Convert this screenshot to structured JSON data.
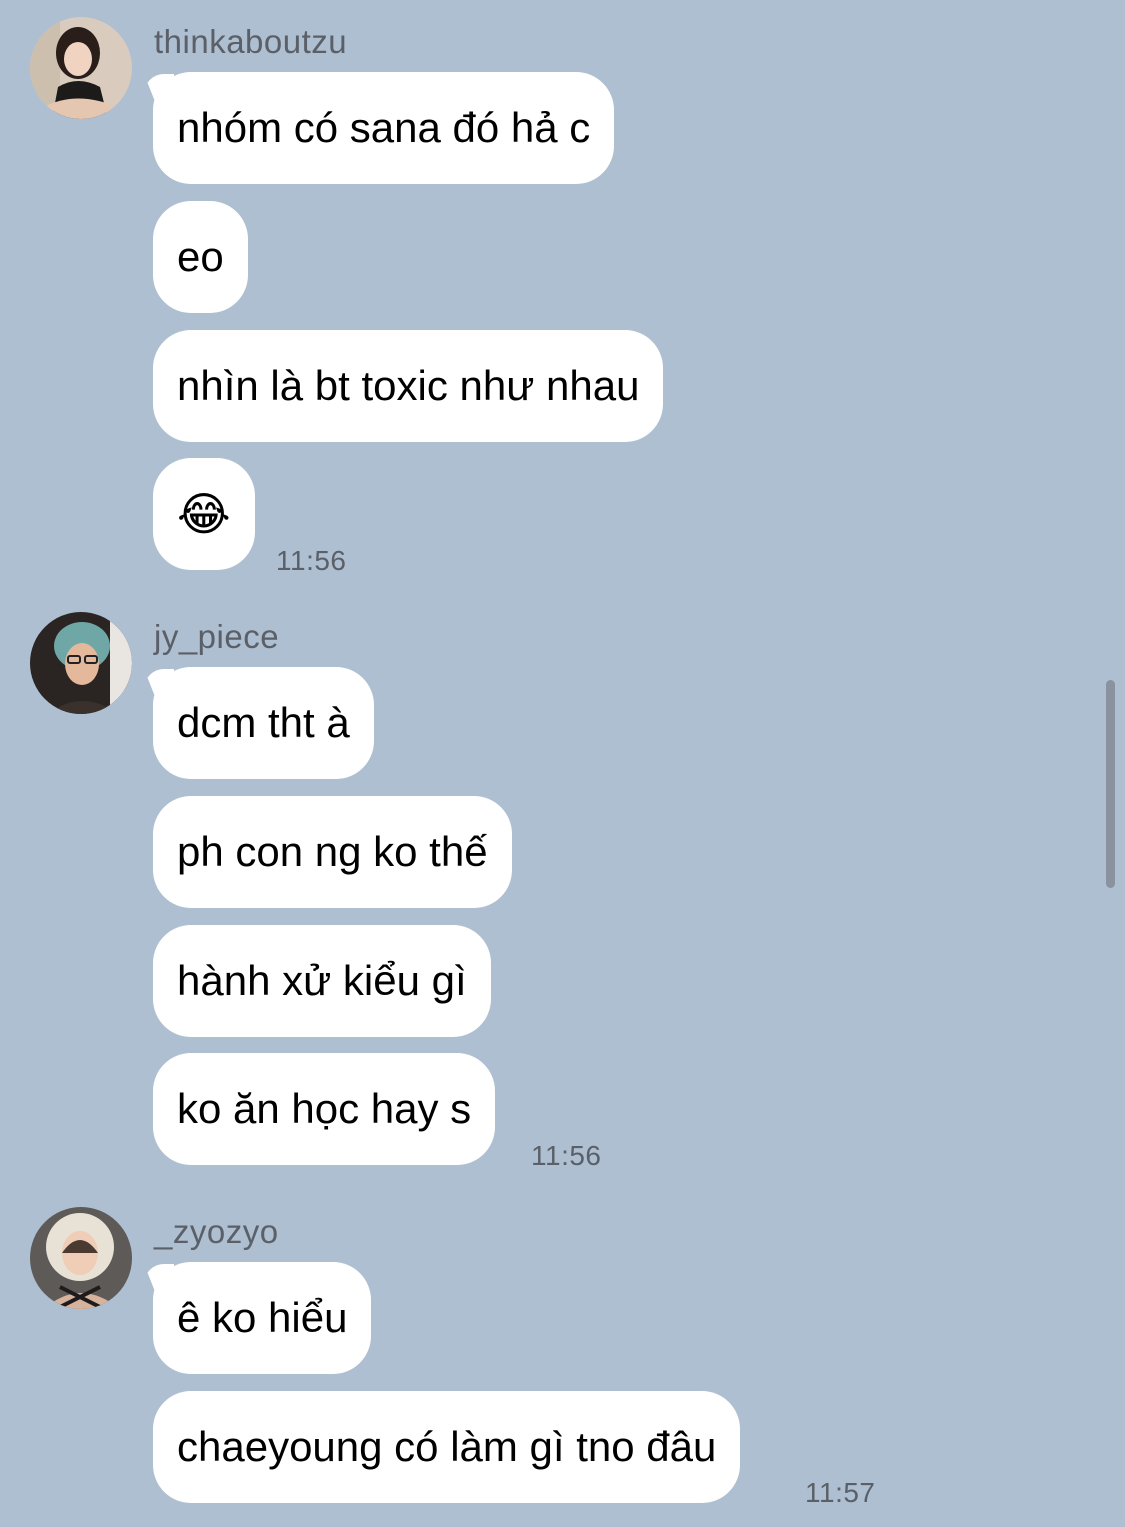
{
  "messages": [
    {
      "sender": "thinkaboutzu",
      "avatar_icon": "user-avatar-photo",
      "bubbles": [
        "nhóm có sana đó hả c",
        "eo",
        "nhìn là bt toxic như nhau",
        "😂"
      ],
      "time": "11:56"
    },
    {
      "sender": "jy_piece",
      "avatar_icon": "user-avatar-photo",
      "bubbles": [
        "dcm tht à",
        "ph con ng ko thế",
        "hành xử kiểu gì",
        "ko ăn học hay s"
      ],
      "time": "11:56"
    },
    {
      "sender": "_zyozyo",
      "avatar_icon": "user-avatar-photo",
      "bubbles": [
        "ê ko hiểu",
        "chaeyoung có làm gì tno đâu"
      ],
      "time": "11:57"
    }
  ],
  "colors": {
    "background": "#aebfd1",
    "bubble": "#ffffff",
    "meta_text": "#5b6068"
  }
}
